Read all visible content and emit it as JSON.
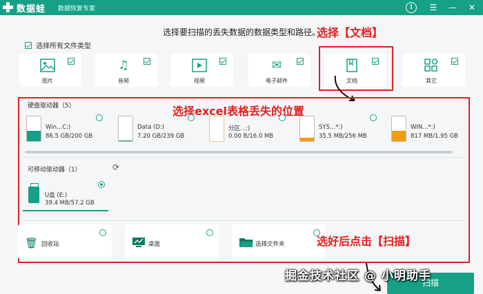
{
  "app": {
    "brand": "数据蛙",
    "subtitle": "数据恢复专家"
  },
  "titlebar_icons": [
    "help-icon",
    "menu-icon",
    "minimize-icon",
    "close-icon"
  ],
  "prompt": "选择要扫描的丢失数据的数据类型和路径。",
  "annotations": {
    "select_doc": "选择【文档】",
    "select_location": "选择excel表格丢失的位置",
    "select_scan": "选好后点击【扫描】"
  },
  "select_all": {
    "label": "选择所有文件类型",
    "checked": true
  },
  "file_types": [
    {
      "label": "图片",
      "icon": "image-icon",
      "checked": true
    },
    {
      "label": "音频",
      "icon": "audio-icon",
      "checked": true
    },
    {
      "label": "视频",
      "icon": "video-icon",
      "checked": true
    },
    {
      "label": "电子邮件",
      "icon": "email-icon",
      "checked": true
    },
    {
      "label": "文档",
      "icon": "document-icon",
      "checked": true
    },
    {
      "label": "其它",
      "icon": "other-icon",
      "checked": true
    }
  ],
  "hard_drives": {
    "label": "硬盘驱动器（5）",
    "items": [
      {
        "name": "Win...C:)",
        "size": "86.5 GB/200 GB",
        "used": 0.43,
        "color": "#16a085"
      },
      {
        "name": "Data (D:)",
        "size": "7.20 GB/239 GB",
        "used": 0.03,
        "color": "#16a085"
      },
      {
        "name": "分区...:)",
        "size": "0.00  B/16.0 MB",
        "used": 0.0,
        "color": "#16a085"
      },
      {
        "name": "SYS...*:)",
        "size": "35.5 MB/256 MB",
        "used": 0.14,
        "color": "#f39c12"
      },
      {
        "name": "WIN...*:)",
        "size": "817 MB/1.95 GB",
        "used": 0.42,
        "color": "#f39c12"
      }
    ]
  },
  "removable_drives": {
    "label": "可移动驱动器（1）",
    "items": [
      {
        "name": "U盘 (E:)",
        "size": "39.4 MB/57.2 GB",
        "selected": true
      }
    ]
  },
  "locations": [
    {
      "label": "回收站",
      "icon": "recycle-bin-icon"
    },
    {
      "label": "桌面",
      "icon": "desktop-icon"
    },
    {
      "label": "选择文件夹",
      "icon": "folder-icon"
    }
  ],
  "scan_button": "扫描",
  "watermark": "掘金技术社区 @ 小明助手",
  "colors": {
    "accent": "#16a085",
    "warning": "#f39c12",
    "annotation": "#e02020"
  }
}
